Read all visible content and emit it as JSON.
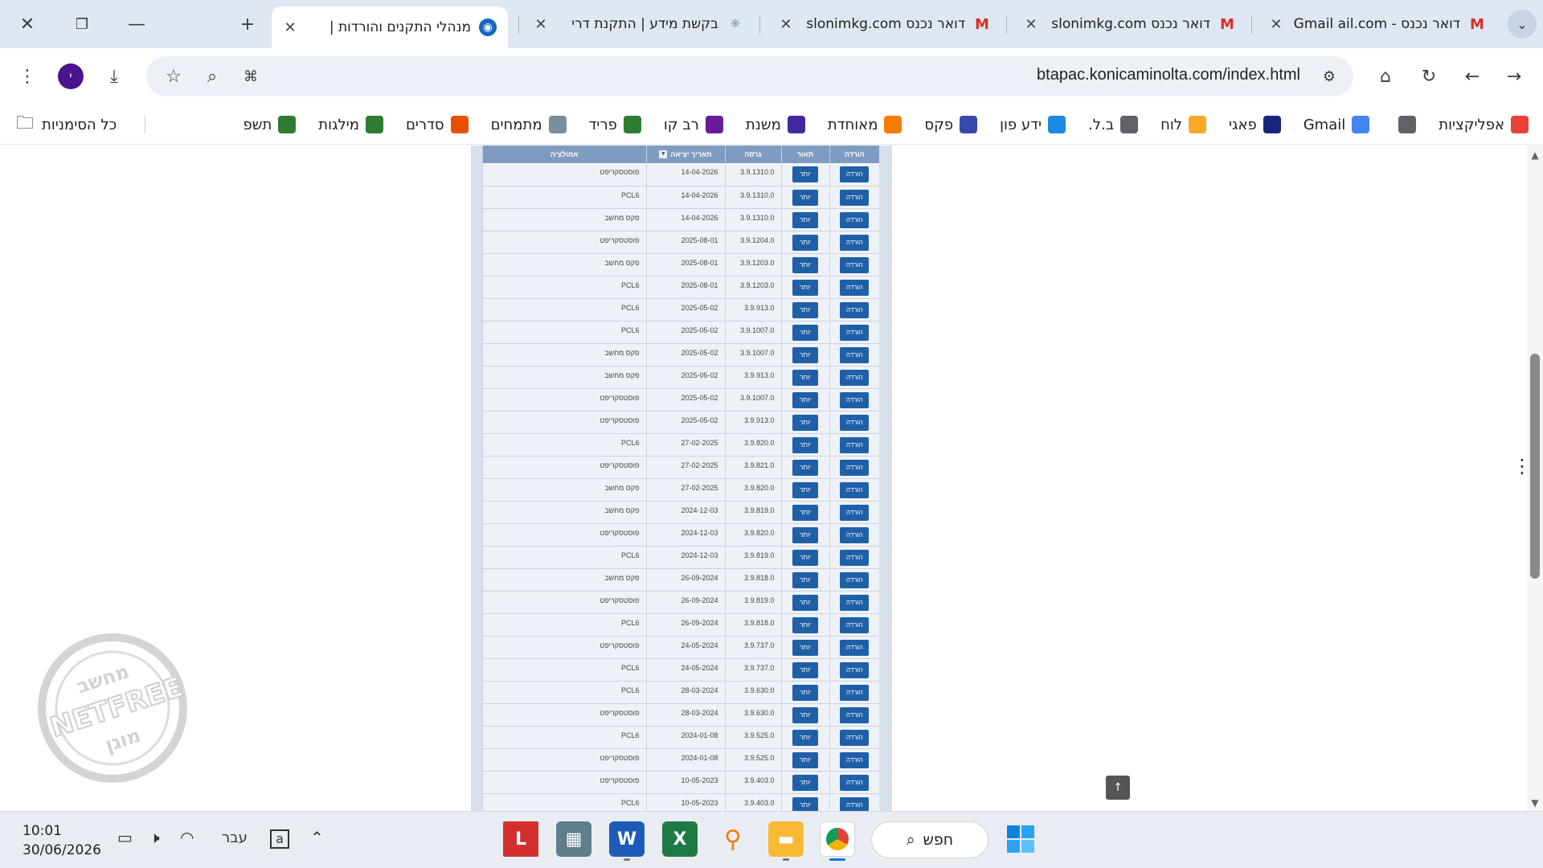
{
  "tabs": [
    {
      "title": "דואר נכנס - Gmail ail.com",
      "icon": "gmail-icon",
      "active": false
    },
    {
      "title": "דואר נכנס slonimkg.com",
      "icon": "gmail-icon",
      "active": false
    },
    {
      "title": "דואר נכנס slonimkg.com",
      "icon": "gmail-icon",
      "active": false
    },
    {
      "title": "בקשת מידע | התקנת דרי",
      "icon": "globe-icon",
      "active": false
    },
    {
      "title": "מנהלי התקנים והורדות |",
      "icon": "konica-icon",
      "active": true
    }
  ],
  "toolbar": {
    "url": "btapac.konicaminolta.com/index.html",
    "avatar_letter": "י"
  },
  "bookmarks": {
    "items": [
      {
        "label": "אפליקציות",
        "icon": "apps-grid-icon",
        "color": "#e94235"
      },
      {
        "label": "",
        "icon": "grid-icon",
        "color": "#5f6368"
      },
      {
        "label": "Gmail",
        "icon": "google-icon",
        "color": "#4285f4"
      },
      {
        "label": "פאגי",
        "icon": "pagi-icon",
        "color": "#1a237e"
      },
      {
        "label": "לוח",
        "icon": "luach-icon",
        "color": "#f9a825"
      },
      {
        "label": "ב.ל.",
        "icon": "document-icon",
        "color": "#5f6368"
      },
      {
        "label": "ידע פון",
        "icon": "yedafon-icon",
        "color": "#1e88e5"
      },
      {
        "label": "פקס",
        "icon": "fax-icon",
        "color": "#3949ab"
      },
      {
        "label": "מאוחדת",
        "icon": "meuhedet-icon",
        "color": "#f57c00"
      },
      {
        "label": "משנת",
        "icon": "mishnat-icon",
        "color": "#4527a0"
      },
      {
        "label": "רב קו",
        "icon": "ravkav-icon",
        "color": "#6a1b9a"
      },
      {
        "label": "פריד",
        "icon": "green-plus-icon",
        "color": "#2e7d32"
      },
      {
        "label": "מתמחים",
        "icon": "globe-icon",
        "color": "#78909c"
      },
      {
        "label": "סדרים",
        "icon": "swirl-icon",
        "color": "#e65100"
      },
      {
        "label": "מילגות",
        "icon": "green-plus-icon",
        "color": "#2e7d32"
      },
      {
        "label": "תשפ",
        "icon": "green-plus-icon",
        "color": "#2e7d32"
      }
    ],
    "all_label": "כל הסימניות"
  },
  "table": {
    "headers": {
      "download": "הורדה",
      "description": "תאור",
      "version": "גרסה",
      "release_date": "תאריך יציאה",
      "emulation": "אמולציה"
    },
    "download_label": "הורדה",
    "description_label": "יותר",
    "rows": [
      {
        "emulation": "פוסטסקריפט",
        "date": "14-04-2026",
        "version": "3.9.1310.0"
      },
      {
        "emulation": "PCL6",
        "date": "14-04-2026",
        "version": "3.9.1310.0"
      },
      {
        "emulation": "פקס מחשב",
        "date": "14-04-2026",
        "version": "3.9.1310.0"
      },
      {
        "emulation": "פוסטסקריפט",
        "date": "2025-08-01",
        "version": "3.9.1204.0"
      },
      {
        "emulation": "פקס מחשב",
        "date": "2025-08-01",
        "version": "3.9.1203.0"
      },
      {
        "emulation": "PCL6",
        "date": "2025-08-01",
        "version": "3.9.1203.0"
      },
      {
        "emulation": "PCL6",
        "date": "2025-05-02",
        "version": "3.9.913.0"
      },
      {
        "emulation": "PCL6",
        "date": "2025-05-02",
        "version": "3.9.1007.0"
      },
      {
        "emulation": "פקס מחשב",
        "date": "2025-05-02",
        "version": "3.9.1007.0"
      },
      {
        "emulation": "פקס מחשב",
        "date": "2025-05-02",
        "version": "3.9.913.0"
      },
      {
        "emulation": "פוסטסקריפט",
        "date": "2025-05-02",
        "version": "3.9.1007.0"
      },
      {
        "emulation": "פוסטסקריפט",
        "date": "2025-05-02",
        "version": "3.9.913.0"
      },
      {
        "emulation": "PCL6",
        "date": "27-02-2025",
        "version": "3.9.820.0"
      },
      {
        "emulation": "פוסטסקריפט",
        "date": "27-02-2025",
        "version": "3.9.821.0"
      },
      {
        "emulation": "פקס מחשב",
        "date": "27-02-2025",
        "version": "3.9.820.0"
      },
      {
        "emulation": "פקס מחשב",
        "date": "2024-12-03",
        "version": "3.9.819.0"
      },
      {
        "emulation": "פוסטסקריפט",
        "date": "2024-12-03",
        "version": "3.9.820.0"
      },
      {
        "emulation": "PCL6",
        "date": "2024-12-03",
        "version": "3.9.819.0"
      },
      {
        "emulation": "פקס מחשב",
        "date": "26-09-2024",
        "version": "3.9.818.0"
      },
      {
        "emulation": "פוסטסקריפט",
        "date": "26-09-2024",
        "version": "3.9.819.0"
      },
      {
        "emulation": "PCL6",
        "date": "26-09-2024",
        "version": "3.9.818.0"
      },
      {
        "emulation": "פוסטסקריפט",
        "date": "24-05-2024",
        "version": "3.9.737.0"
      },
      {
        "emulation": "PCL6",
        "date": "24-05-2024",
        "version": "3.9.737.0"
      },
      {
        "emulation": "PCL6",
        "date": "28-03-2024",
        "version": "3.9.630.0"
      },
      {
        "emulation": "פוסטסקריפט",
        "date": "28-03-2024",
        "version": "3.9.630.0"
      },
      {
        "emulation": "PCL6",
        "date": "2024-01-08",
        "version": "3.9.525.0"
      },
      {
        "emulation": "פוסטסקריפט",
        "date": "2024-01-08",
        "version": "3.9.525.0"
      },
      {
        "emulation": "פוסטסקריפט",
        "date": "10-05-2023",
        "version": "3.9.403.0"
      },
      {
        "emulation": "PCL6",
        "date": "10-05-2023",
        "version": "3.9.403.0"
      }
    ]
  },
  "watermark": {
    "top": "מחשב",
    "middle": "NETFREE",
    "bottom": "מוגן"
  },
  "taskbar": {
    "time": "10:01",
    "date": "30/06/2026",
    "language": "עבר",
    "search_label": "חפש"
  }
}
